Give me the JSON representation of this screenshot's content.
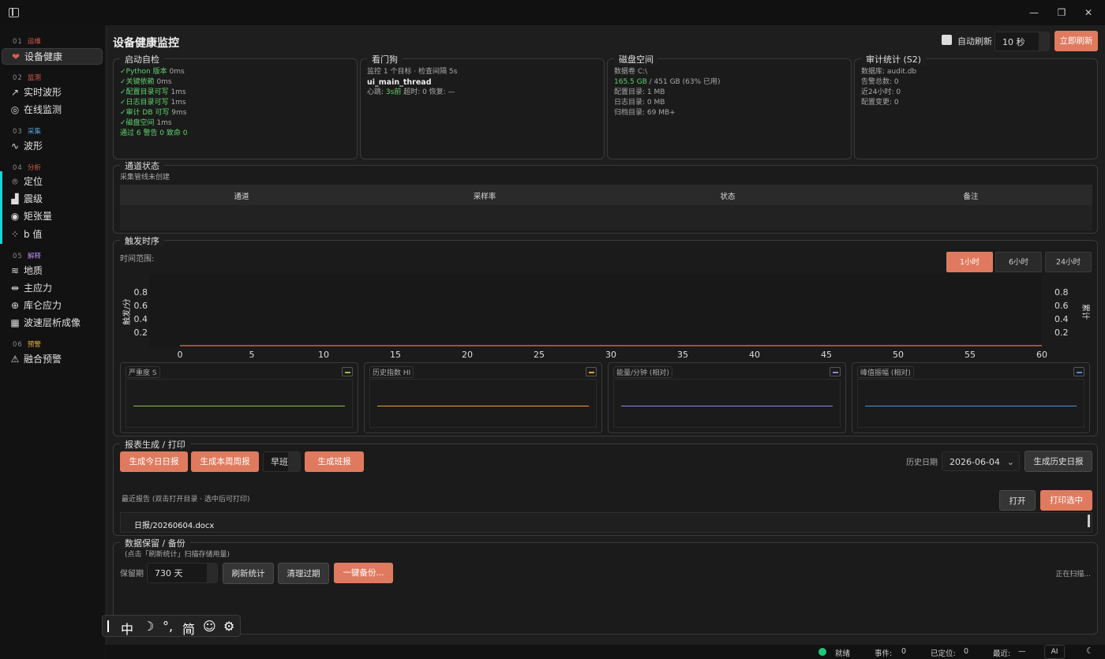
{
  "sidebar": {
    "sections": [
      {
        "num": "01",
        "label": "运维",
        "color": "#e05a4f"
      },
      {
        "num": "02",
        "label": "监测",
        "color": "#e05a4f"
      },
      {
        "num": "03",
        "label": "采集",
        "color": "#4fa3e0"
      },
      {
        "num": "04",
        "label": "分析",
        "color": "#e05a4f"
      },
      {
        "num": "05",
        "label": "解释",
        "color": "#b58cf0"
      },
      {
        "num": "06",
        "label": "预警",
        "color": "#f0b341"
      }
    ],
    "items": [
      {
        "label": "设备健康",
        "icon": "heart-pulse-icon"
      },
      {
        "label": "实时波形",
        "icon": "trend-icon"
      },
      {
        "label": "在线监测",
        "icon": "radar-icon"
      },
      {
        "label": "波形",
        "icon": "sine-wave-icon"
      },
      {
        "label": "定位",
        "icon": "map-pin-icon"
      },
      {
        "label": "震级",
        "icon": "bar-chart-icon"
      },
      {
        "label": "矩张量",
        "icon": "target-icon"
      },
      {
        "label": "b 值",
        "icon": "scatter-icon"
      },
      {
        "label": "地质",
        "icon": "layers-icon"
      },
      {
        "label": "主应力",
        "icon": "stress-icon"
      },
      {
        "label": "库仑应力",
        "icon": "crosshair-icon"
      },
      {
        "label": "波速层析成像",
        "icon": "grid-icon"
      },
      {
        "label": "融合预警",
        "icon": "warning-icon"
      }
    ]
  },
  "header": {
    "title": "设备健康监控",
    "auto_refresh_label": "自动刷新",
    "interval_value": "10 秒",
    "refresh_now": "立即刷新"
  },
  "selfcheck": {
    "title": "启动自检",
    "items": [
      {
        "name": "Python 版本",
        "time": "0ms"
      },
      {
        "name": "关键依赖",
        "time": "0ms"
      },
      {
        "name": "配置目录可写",
        "time": "1ms"
      },
      {
        "name": "日志目录可写",
        "time": "1ms"
      },
      {
        "name": "审计 DB 可写",
        "time": "9ms"
      },
      {
        "name": "磁盘空间",
        "time": "1ms"
      }
    ],
    "check_mark": "✓",
    "summary": "通过 6  警告 0  致命 0"
  },
  "watchdog": {
    "title": "看门狗",
    "line1": "监控 1 个目标 · 检查间隔 5s",
    "thread": "ui_main_thread",
    "hb_label": "心跳: ",
    "hb_value": "3s前",
    "hb_rest": " 超时: 0 恢复: —"
  },
  "disk": {
    "title": "磁盘空间",
    "volume": "数据卷 C:\\",
    "free": "165.5 GB",
    "total": " / 451 GB (63% 已用)",
    "config": "配置目录: 1 MB",
    "logs": "日志目录: 0 MB",
    "archive": "归档目录: 69 MB+"
  },
  "audit": {
    "title": "审计统计 (S2)",
    "db": "数据库: audit.db",
    "alarms": "告警总数: 0",
    "recent": "近24小时: 0",
    "config_changes": "配置变更: 0"
  },
  "channels": {
    "title": "通道状态",
    "note": "采集管线未创建",
    "columns": [
      "通道",
      "采样率",
      "状态",
      "备注"
    ]
  },
  "trigger": {
    "title": "触发时序",
    "range_label": "时间范围:",
    "ranges": [
      "1小时",
      "6小时",
      "24小时"
    ],
    "selected_range": "1小时",
    "mini_panels": [
      {
        "title": "严重度 S",
        "color": "#8bc34a"
      },
      {
        "title": "历史指数 HI",
        "color": "#f0a030"
      },
      {
        "title": "能量/分钟 (相对)",
        "color": "#8f88f0"
      },
      {
        "title": "峰值振幅 (相对)",
        "color": "#4f8fd8"
      }
    ]
  },
  "chart_data": {
    "type": "line",
    "ylabel": "触发/分",
    "ylabel_right": "累计",
    "x_ticks": [
      0,
      5,
      10,
      15,
      20,
      25,
      30,
      35,
      40,
      45,
      50,
      55,
      60
    ],
    "y_ticks": [
      0.8,
      0.6,
      0.4,
      0.2
    ],
    "y2_ticks": [
      0.8,
      0.6,
      0.4,
      0.2
    ],
    "xlim": [
      0,
      60
    ],
    "ylim": [
      0,
      1
    ],
    "series": [
      {
        "values": [
          [
            0,
            0
          ],
          [
            60,
            0
          ]
        ],
        "color": "#e07a5f"
      }
    ]
  },
  "reports": {
    "title": "报表生成 / 打印",
    "daily": "生成今日日报",
    "weekly": "生成本周周报",
    "shift_value": "早班",
    "shift_report": "生成班报",
    "history_label": "历史日期",
    "history_date": "2026-06-04",
    "history_btn": "生成历史日报",
    "recent_label": "最近报告 (双击打开目录 · 选中后可打印)",
    "open": "打开",
    "print": "打印选中",
    "files": [
      "日报/20260604.docx"
    ]
  },
  "retention": {
    "title": "数据保留 / 备份",
    "hint": "(点击「刷新统计」扫描存储用量)",
    "period_label": "保留期",
    "period_value": "730 天",
    "refresh": "刷新统计",
    "clean": "清理过期",
    "backup": "一键备份...",
    "scanning": "正在扫描..."
  },
  "ime": {
    "chars": [
      "中",
      "☽",
      "°,",
      "简",
      "☺",
      "⚙"
    ]
  },
  "status": {
    "ready": "就绪",
    "events_label": "事件:",
    "events": "0",
    "located_label": "已定位:",
    "located": "0",
    "recent_label": "最近:",
    "recent": "—",
    "ai": "AI"
  }
}
